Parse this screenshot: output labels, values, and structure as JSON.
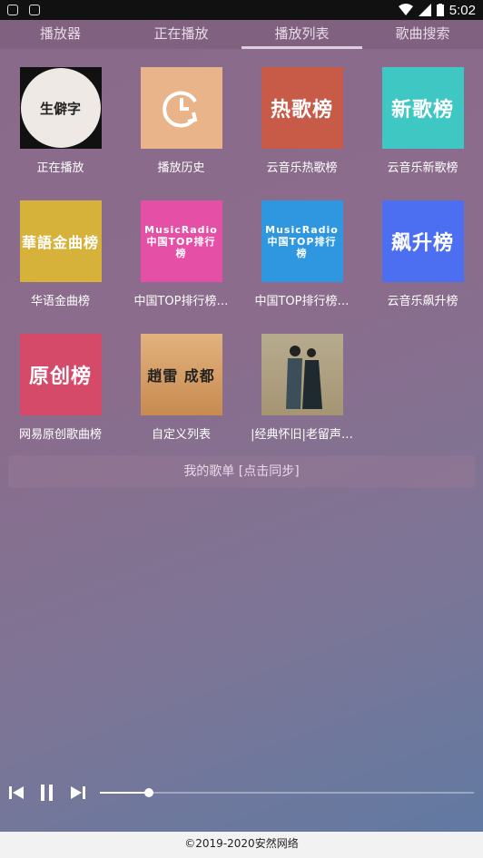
{
  "status": {
    "time": "5:02"
  },
  "tabs": [
    {
      "label": "播放器"
    },
    {
      "label": "正在播放"
    },
    {
      "label": "播放列表"
    },
    {
      "label": "歌曲搜索"
    }
  ],
  "playlists": [
    {
      "caption": "正在播放",
      "cover_text": "生僻字",
      "bg": "#2a1a1a"
    },
    {
      "caption": "播放历史",
      "cover_text": "",
      "bg": "#e9b48a"
    },
    {
      "caption": "云音乐热歌榜",
      "cover_text": "热歌榜",
      "bg": "#c85a48"
    },
    {
      "caption": "云音乐新歌榜",
      "cover_text": "新歌榜",
      "bg": "#3fc7c4"
    },
    {
      "caption": "华语金曲榜",
      "cover_text": "華語金曲榜",
      "bg": "#d6b23a"
    },
    {
      "caption": "中国TOP排行榜…",
      "cover_text": "MusicRadio 中国TOP排行榜",
      "bg": "#e64fa6"
    },
    {
      "caption": "中国TOP排行榜…",
      "cover_text": "MusicRadio 中国TOP排行榜",
      "bg": "#2e97df"
    },
    {
      "caption": "云音乐飙升榜",
      "cover_text": "飙升榜",
      "bg": "#4b6ff0"
    },
    {
      "caption": "网易原创歌曲榜",
      "cover_text": "原创榜",
      "bg": "#d64a69"
    },
    {
      "caption": "自定义列表",
      "cover_text": "趙雷 成都",
      "bg": "#d8a36a"
    },
    {
      "caption": "|经典怀旧|老留声…",
      "cover_text": "",
      "bg": "#b9a98d"
    }
  ],
  "my_playlist_label": "我的歌单 [点击同步]",
  "player": {
    "progress": 0.13
  },
  "footer": "©2019-2020安然网络"
}
